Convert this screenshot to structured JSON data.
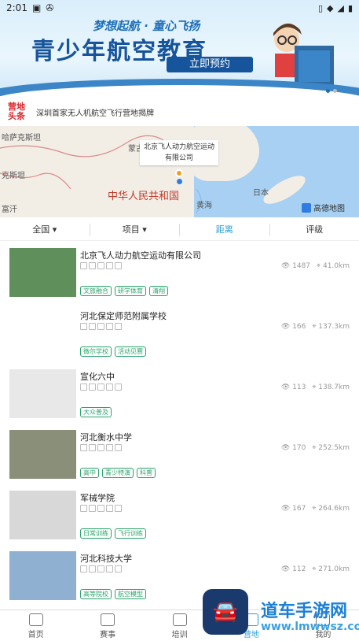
{
  "status_bar": {
    "time": "2:01"
  },
  "banner": {
    "slogan": "梦想起航 · 童心飞扬",
    "title": "青少年航空教育",
    "cta": "立即预约"
  },
  "news": {
    "tag_line1": "营地",
    "tag_line2": "头条",
    "headline": "深圳首家无人机航空飞行营地揭牌"
  },
  "map": {
    "labels": [
      "哈萨克斯坦",
      "蒙古",
      "克斯坦",
      "富汗",
      "日本",
      "黄海"
    ],
    "country": "中华人民共和国",
    "popup_line1": "北京飞人动力航空运动",
    "popup_line2": "有限公司",
    "provider": "高德地图"
  },
  "filters": [
    {
      "label": "全国",
      "arrow": "▾"
    },
    {
      "label": "项目",
      "arrow": "▾"
    },
    {
      "label": "距离",
      "arrow": ""
    },
    {
      "label": "评级",
      "arrow": ""
    }
  ],
  "items": [
    {
      "name": "北京飞人动力航空运动有限公司",
      "views": "1487",
      "distance": "41.0km",
      "tags": [
        "文旅融合",
        "研学体育",
        "清翔"
      ]
    },
    {
      "name": "河北保定师范附属学校",
      "views": "166",
      "distance": "137.3km",
      "tags": [
        "微尔学校",
        "活动见赛"
      ]
    },
    {
      "name": "宣化六中",
      "views": "113",
      "distance": "138.7km",
      "tags": [
        "大众普及"
      ]
    },
    {
      "name": "河北衡水中学",
      "views": "170",
      "distance": "252.5km",
      "tags": [
        "高中",
        "青少特演",
        "科普"
      ]
    },
    {
      "name": "军械学院",
      "views": "167",
      "distance": "264.6km",
      "tags": [
        "日常训练",
        "飞行训练"
      ]
    },
    {
      "name": "河北科技大学",
      "views": "112",
      "distance": "271.0km",
      "tags": [
        "高等院校",
        "航空模型"
      ]
    }
  ],
  "tabbar": [
    {
      "label": "首页"
    },
    {
      "label": "赛事"
    },
    {
      "label": "培训"
    },
    {
      "label": "营地"
    },
    {
      "label": "我的"
    }
  ],
  "watermark": {
    "title": "道车手游网",
    "url": "www.lmwwsz.com"
  }
}
